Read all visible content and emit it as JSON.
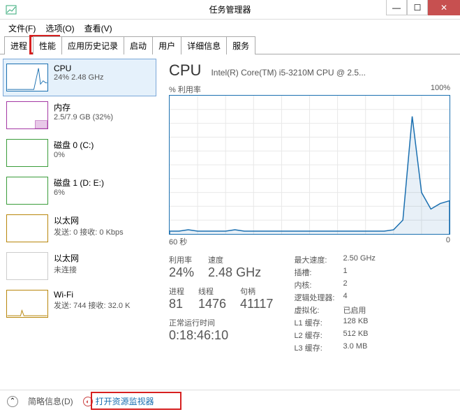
{
  "window": {
    "title": "任务管理器",
    "min": "—",
    "max": "☐",
    "close": "✕"
  },
  "menu": {
    "file": "文件(F)",
    "options": "选项(O)",
    "view": "查看(V)"
  },
  "tabs": {
    "t0": "进程",
    "t1": "性能",
    "t2": "应用历史记录",
    "t3": "启动",
    "t4": "用户",
    "t5": "详细信息",
    "t6": "服务"
  },
  "sidebar": {
    "cpu": {
      "title": "CPU",
      "sub": "24% 2.48 GHz"
    },
    "mem": {
      "title": "内存",
      "sub": "2.5/7.9 GB (32%)"
    },
    "disk0": {
      "title": "磁盘 0 (C:)",
      "sub": "0%"
    },
    "disk1": {
      "title": "磁盘 1 (D: E:)",
      "sub": "6%"
    },
    "eth0": {
      "title": "以太网",
      "sub": "发送: 0 接收: 0 Kbps"
    },
    "eth1": {
      "title": "以太网",
      "sub": "未连接"
    },
    "wifi": {
      "title": "Wi-Fi",
      "sub": "发送: 744 接收: 32.0 K"
    }
  },
  "main": {
    "heading": "CPU",
    "desc": "Intel(R) Core(TM) i5-3210M CPU @ 2.5...",
    "chart_ylabel": "% 利用率",
    "chart_ymax": "100%",
    "chart_xmin": "60 秒",
    "chart_xmax": "0",
    "util_lbl": "利用率",
    "util_val": "24%",
    "speed_lbl": "速度",
    "speed_val": "2.48 GHz",
    "proc_lbl": "进程",
    "proc_val": "81",
    "thread_lbl": "线程",
    "thread_val": "1476",
    "handle_lbl": "句柄",
    "handle_val": "41117",
    "uptime_lbl": "正常运行时间",
    "uptime_val": "0:18:46:10",
    "maxspeed_k": "最大速度:",
    "maxspeed_v": "2.50 GHz",
    "sockets_k": "插槽:",
    "sockets_v": "1",
    "cores_k": "内核:",
    "cores_v": "2",
    "logical_k": "逻辑处理器:",
    "logical_v": "4",
    "virt_k": "虚拟化:",
    "virt_v": "已启用",
    "l1_k": "L1 缓存:",
    "l1_v": "128 KB",
    "l2_k": "L2 缓存:",
    "l2_v": "512 KB",
    "l3_k": "L3 缓存:",
    "l3_v": "3.0 MB"
  },
  "footer": {
    "brief": "简略信息(D)",
    "resmon": "打开资源监视器"
  },
  "chart_data": {
    "type": "line",
    "title": "% 利用率",
    "xlabel": "60 秒 → 0",
    "ylabel": "%",
    "ylim": [
      0,
      100
    ],
    "x": [
      0,
      2,
      4,
      6,
      8,
      10,
      12,
      14,
      16,
      18,
      20,
      22,
      24,
      26,
      28,
      30,
      32,
      34,
      36,
      38,
      40,
      42,
      44,
      46,
      48,
      50,
      52,
      54,
      56,
      58,
      60
    ],
    "values": [
      2,
      2,
      3,
      2,
      2,
      2,
      2,
      3,
      2,
      2,
      2,
      2,
      2,
      2,
      2,
      2,
      2,
      2,
      2,
      2,
      2,
      2,
      2,
      2,
      3,
      10,
      85,
      30,
      18,
      22,
      24
    ]
  }
}
